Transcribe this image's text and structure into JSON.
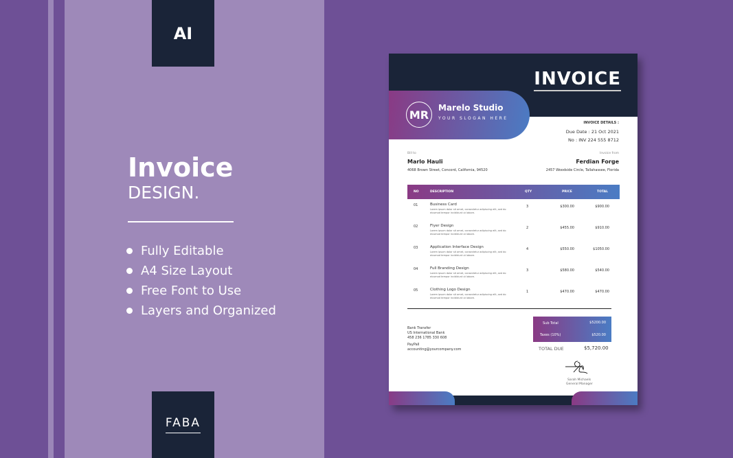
{
  "badge_top": "AI",
  "badge_bottom": "FABA",
  "heading": "Invoice",
  "subheading": "DESIGN.",
  "features": [
    "Fully Editable",
    "A4 Size Layout",
    "Free Font to Use",
    "Layers and Organized"
  ],
  "invoice": {
    "title": "INVOICE",
    "brand": "Marelo Studio",
    "logo": "MR",
    "slogan": "YOUR SLOGAN HERE",
    "details_label": "INVOICE DETAILS :",
    "due_date": "Due Date : 21 Oct 2021",
    "number": "No : INV 224 555 8712",
    "bill_to_label": "Bill to",
    "bill_to_name": "Marlo Hauli",
    "bill_to_address": "4068 Brown Street, Concord, California, 94520",
    "from_label": "Invoice from",
    "from_name": "Ferdian Forge",
    "from_address": "2457 Woodside Circle, Tallahassee, Florida",
    "columns": [
      "NO",
      "DESCRIPTION",
      "QTY",
      "PRICE",
      "TOTAL"
    ],
    "lorem": "Lorem ipsum dolor sit amet, consectetur adipiscing elit, sed do eiusmod tempor incididunt ut labore.",
    "rows": [
      {
        "no": "01",
        "desc": "Business Card",
        "qty": "3",
        "price": "$300.00",
        "total": "$900.00"
      },
      {
        "no": "02",
        "desc": "Flyer Design",
        "qty": "2",
        "price": "$455.00",
        "total": "$910.00"
      },
      {
        "no": "03",
        "desc": "Application Interface Design",
        "qty": "4",
        "price": "$550.00",
        "total": "$1050.00"
      },
      {
        "no": "04",
        "desc": "Full Branding Design",
        "qty": "3",
        "price": "$580.00",
        "total": "$540.00"
      },
      {
        "no": "05",
        "desc": "Clothing Logo Design",
        "qty": "1",
        "price": "$470.00",
        "total": "$470.00"
      }
    ],
    "bank_label": "Bank Transfer",
    "bank_name": "US International Bank",
    "bank_number": "458 236 1785 330 608",
    "paypal_label": "PayPall",
    "paypal_email": "accounting@yourcompany.com",
    "subtotal_label": "Sub Total",
    "subtotal": "$5200.00",
    "taxes_label": "Taxes (10%)",
    "taxes": "$520.00",
    "total_label": "TOTAL DUE",
    "total": "$5,720.00",
    "signer": "Sarah Michaels",
    "signer_title": "General Manager"
  },
  "colors": {
    "background": "#6e5096",
    "panel": "#9e89b9",
    "navy": "#1a2438",
    "gradient_start": "#8a3a84",
    "gradient_end": "#4a7cc4"
  }
}
